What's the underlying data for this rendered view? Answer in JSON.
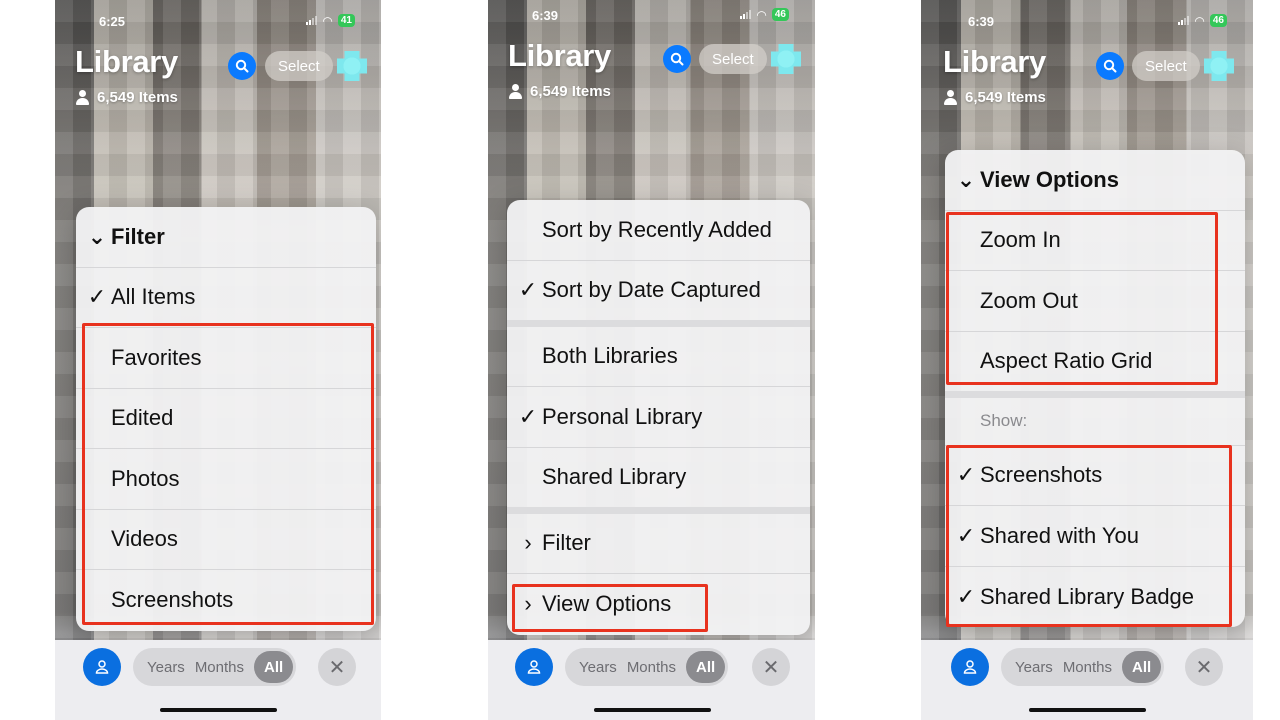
{
  "panels": [
    {
      "status": {
        "time": "6:25",
        "battery": "41"
      },
      "header": {
        "title": "Library",
        "item_count": "6,549 Items",
        "select_label": "Select"
      },
      "menu": {
        "items": [
          {
            "label": "Filter",
            "mark": "⌄",
            "type": "header",
            "expanded": true
          },
          {
            "label": "All Items",
            "mark": "✓",
            "checked": true
          },
          {
            "label": "Favorites",
            "mark": ""
          },
          {
            "label": "Edited",
            "mark": ""
          },
          {
            "label": "Photos",
            "mark": ""
          },
          {
            "label": "Videos",
            "mark": ""
          },
          {
            "label": "Screenshots",
            "mark": ""
          }
        ]
      },
      "bottom_bar": {
        "segments": [
          "Years",
          "Months",
          "All"
        ],
        "selected": "All",
        "close_label": "✕"
      }
    },
    {
      "status": {
        "time": "6:39",
        "battery": "46"
      },
      "header": {
        "title": "Library",
        "item_count": "6,549 Items",
        "select_label": "Select"
      },
      "menu": {
        "items": [
          {
            "label": "Sort by Recently Added",
            "mark": ""
          },
          {
            "label": "Sort by Date Captured",
            "mark": "✓",
            "checked": true
          },
          {
            "label": "Both Libraries",
            "mark": ""
          },
          {
            "label": "Personal Library",
            "mark": "✓",
            "checked": true
          },
          {
            "label": "Shared Library",
            "mark": ""
          },
          {
            "label": "Filter",
            "mark": "›",
            "type": "submenu"
          },
          {
            "label": "View Options",
            "mark": "›",
            "type": "submenu"
          }
        ]
      },
      "bottom_bar": {
        "segments": [
          "Years",
          "Months",
          "All"
        ],
        "selected": "All",
        "close_label": "✕"
      }
    },
    {
      "status": {
        "time": "6:39",
        "battery": "46"
      },
      "header": {
        "title": "Library",
        "item_count": "6,549 Items",
        "select_label": "Select"
      },
      "menu": {
        "items": [
          {
            "label": "View Options",
            "mark": "⌄",
            "type": "header",
            "expanded": true
          },
          {
            "label": "Zoom In",
            "mark": ""
          },
          {
            "label": "Zoom Out",
            "mark": ""
          },
          {
            "label": "Aspect Ratio Grid",
            "mark": ""
          }
        ],
        "show_label": "Show:",
        "show_items": [
          {
            "label": "Screenshots",
            "mark": "✓",
            "checked": true
          },
          {
            "label": "Shared with You",
            "mark": "✓",
            "checked": true
          },
          {
            "label": "Shared Library Badge",
            "mark": "✓",
            "checked": true
          }
        ]
      },
      "bottom_bar": {
        "segments": [
          "Years",
          "Months",
          "All"
        ],
        "selected": "All",
        "close_label": "✕"
      }
    }
  ],
  "colors": {
    "accent": "#0a7aff",
    "highlight": "#e8321e",
    "battery": "#34c759"
  }
}
